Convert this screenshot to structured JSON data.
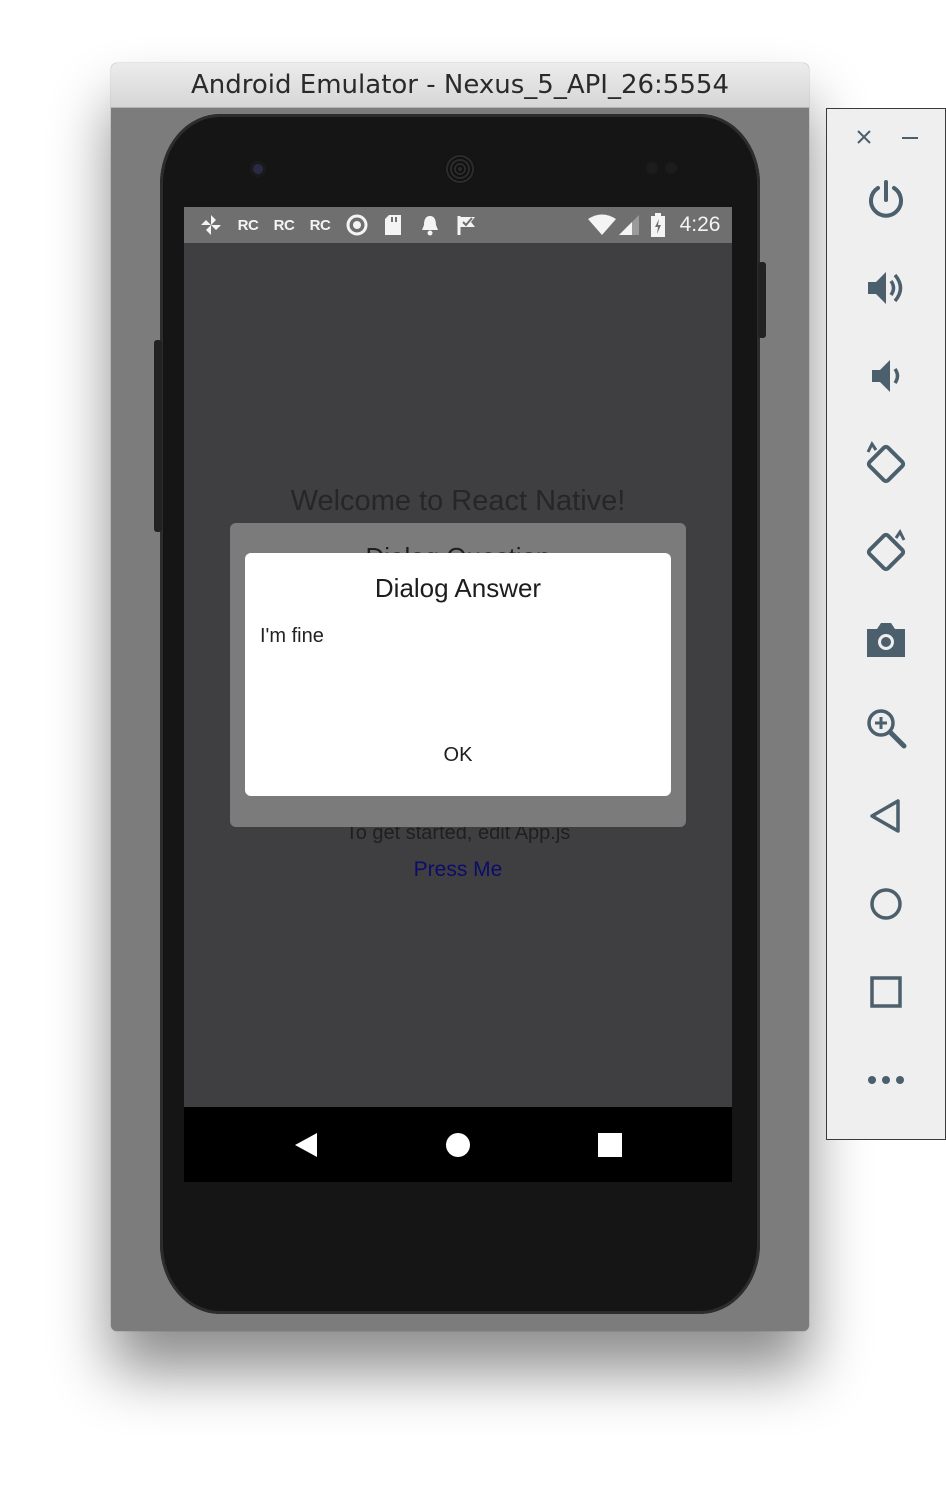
{
  "window": {
    "title": "Android Emulator - Nexus_5_API_26:5554"
  },
  "status_bar": {
    "rc_labels": [
      "RC",
      "RC",
      "RC"
    ],
    "time": "4:26",
    "icons": [
      "pinwheel-icon",
      "rc-icon",
      "rc-icon",
      "rc-icon",
      "circle-icon",
      "sd-card-icon",
      "bell-icon",
      "check-flag-icon",
      "wifi-icon",
      "signal-icon",
      "battery-icon"
    ]
  },
  "app": {
    "welcome": "Welcome to React Native!",
    "instructions": "To get started, edit App.js",
    "button_label": "Press Me",
    "background_dialog_title": "Dialog Question"
  },
  "dialog": {
    "title": "Dialog Answer",
    "message": "I'm fine",
    "ok_label": "OK"
  },
  "nav_bar": {
    "icons": [
      "back-icon",
      "home-icon",
      "recents-icon"
    ]
  },
  "toolbar": {
    "icons": [
      "close-icon",
      "minimize-icon",
      "power-icon",
      "volume-up-icon",
      "volume-down-icon",
      "rotate-left-icon",
      "rotate-right-icon",
      "camera-icon",
      "zoom-icon",
      "back-icon",
      "home-icon",
      "overview-icon",
      "more-icon"
    ]
  },
  "colors": {
    "window_bg": "#7c7c7c",
    "screen_bg": "#3f3f41",
    "status_bar": "#6f6f6f",
    "dialog_bg": "#ffffff",
    "link_text": "#0c0c6a",
    "toolbar_icon": "#4b5f6c"
  }
}
